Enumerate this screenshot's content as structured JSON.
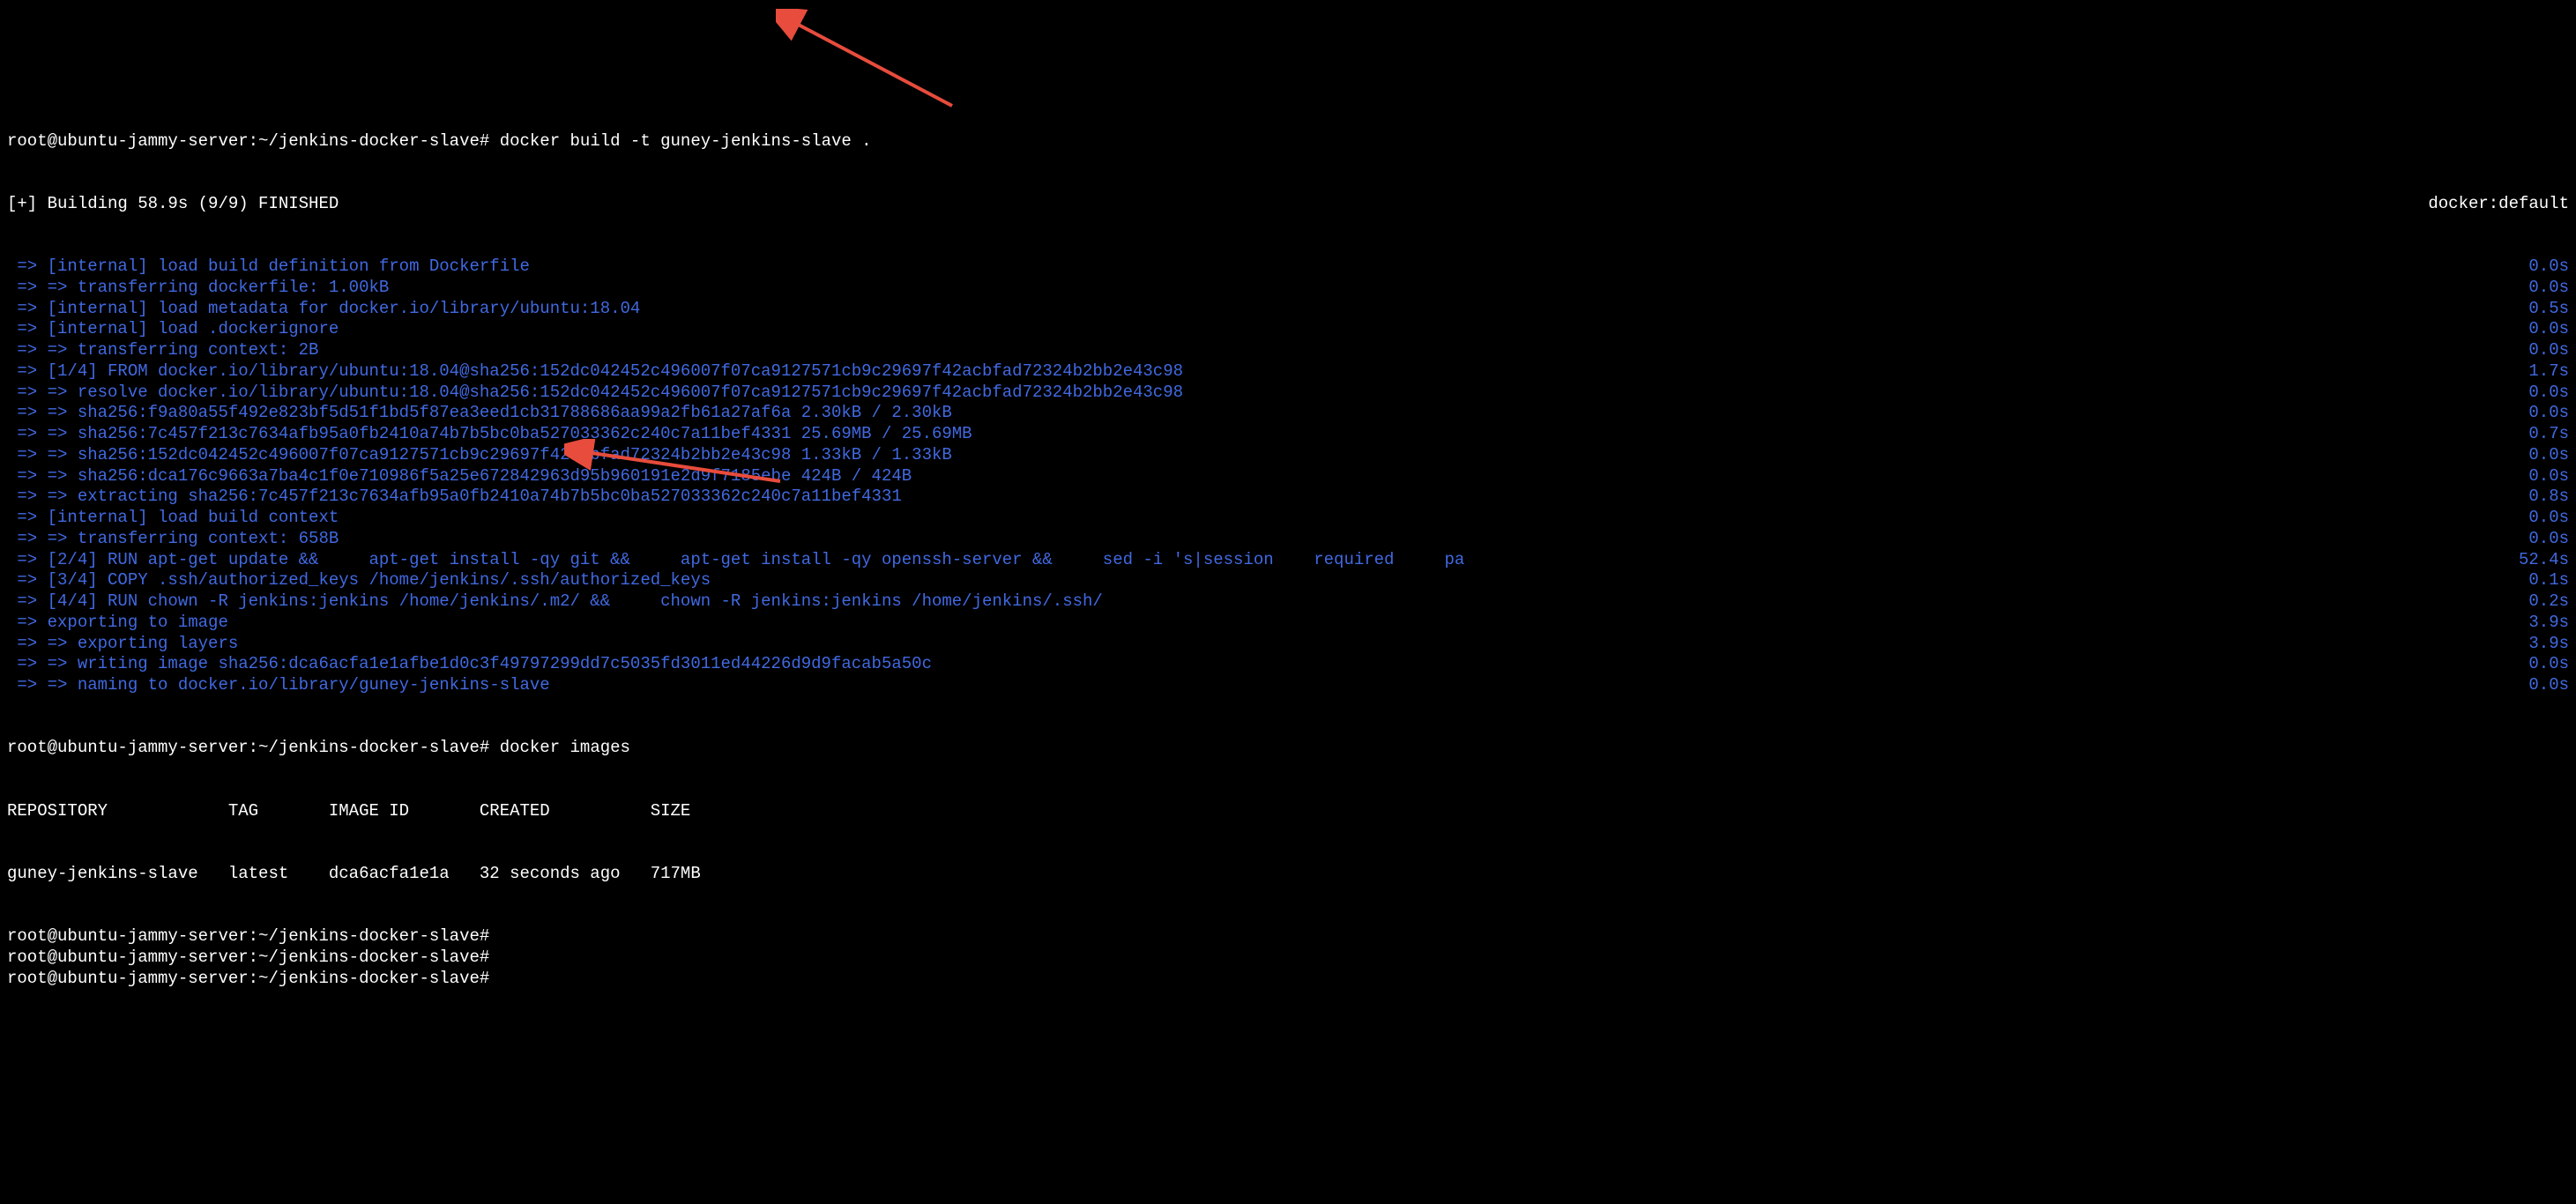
{
  "prompt_text": "root@ubuntu-jammy-server:~/jenkins-docker-slave#",
  "command1": "docker build -t guney-jenkins-slave .",
  "building_line": "[+] Building 58.9s (9/9) FINISHED",
  "docker_default": "docker:default",
  "steps": [
    {
      "text": "=> [internal] load build definition from Dockerfile",
      "time": "0.0s"
    },
    {
      "text": "=> => transferring dockerfile: 1.00kB",
      "time": "0.0s"
    },
    {
      "text": "=> [internal] load metadata for docker.io/library/ubuntu:18.04",
      "time": "0.5s"
    },
    {
      "text": "=> [internal] load .dockerignore",
      "time": "0.0s"
    },
    {
      "text": "=> => transferring context: 2B",
      "time": "0.0s"
    },
    {
      "text": "=> [1/4] FROM docker.io/library/ubuntu:18.04@sha256:152dc042452c496007f07ca9127571cb9c29697f42acbfad72324b2bb2e43c98",
      "time": "1.7s"
    },
    {
      "text": "=> => resolve docker.io/library/ubuntu:18.04@sha256:152dc042452c496007f07ca9127571cb9c29697f42acbfad72324b2bb2e43c98",
      "time": "0.0s"
    },
    {
      "text": "=> => sha256:f9a80a55f492e823bf5d51f1bd5f87ea3eed1cb31788686aa99a2fb61a27af6a 2.30kB / 2.30kB",
      "time": "0.0s"
    },
    {
      "text": "=> => sha256:7c457f213c7634afb95a0fb2410a74b7b5bc0ba527033362c240c7a11bef4331 25.69MB / 25.69MB",
      "time": "0.7s"
    },
    {
      "text": "=> => sha256:152dc042452c496007f07ca9127571cb9c29697f42acbfad72324b2bb2e43c98 1.33kB / 1.33kB",
      "time": "0.0s"
    },
    {
      "text": "=> => sha256:dca176c9663a7ba4c1f0e710986f5a25e672842963d95b960191e2d9f7185ebe 424B / 424B",
      "time": "0.0s"
    },
    {
      "text": "=> => extracting sha256:7c457f213c7634afb95a0fb2410a74b7b5bc0ba527033362c240c7a11bef4331",
      "time": "0.8s"
    },
    {
      "text": "=> [internal] load build context",
      "time": "0.0s"
    },
    {
      "text": "=> => transferring context: 658B",
      "time": "0.0s"
    },
    {
      "text": "=> [2/4] RUN apt-get update &&     apt-get install -qy git &&     apt-get install -qy openssh-server &&     sed -i 's|session    required     pa",
      "time": "52.4s"
    },
    {
      "text": "=> [3/4] COPY .ssh/authorized_keys /home/jenkins/.ssh/authorized_keys",
      "time": "0.1s"
    },
    {
      "text": "=> [4/4] RUN chown -R jenkins:jenkins /home/jenkins/.m2/ &&     chown -R jenkins:jenkins /home/jenkins/.ssh/",
      "time": "0.2s"
    },
    {
      "text": "=> exporting to image",
      "time": "3.9s"
    },
    {
      "text": "=> => exporting layers",
      "time": "3.9s"
    },
    {
      "text": "=> => writing image sha256:dca6acfa1e1afbe1d0c3f49797299dd7c5035fd3011ed44226d9d9facab5a50c",
      "time": "0.0s"
    },
    {
      "text": "=> => naming to docker.io/library/guney-jenkins-slave",
      "time": "0.0s"
    }
  ],
  "command2": "docker images",
  "table": {
    "headers": {
      "repo": "REPOSITORY",
      "tag": "TAG",
      "id": "IMAGE ID",
      "created": "CREATED",
      "size": "SIZE"
    },
    "row": {
      "repo": "guney-jenkins-slave",
      "tag": "latest",
      "id": "dca6acfa1e1a",
      "created": "32 seconds ago",
      "size": "717MB"
    }
  },
  "empty_prompts": 3
}
